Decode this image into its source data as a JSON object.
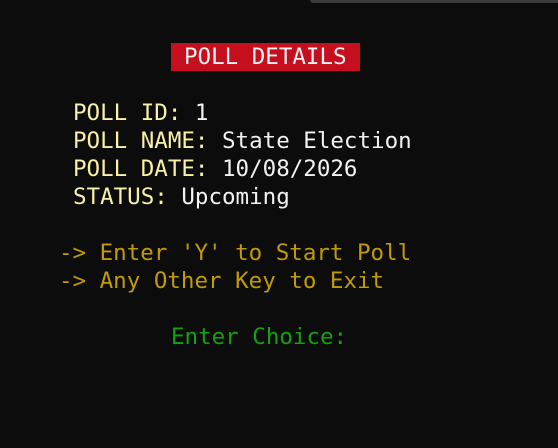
{
  "header": {
    "title": "POLL DETAILS"
  },
  "details": [
    {
      "key": "POLL ID:",
      "value": "1"
    },
    {
      "key": "POLL NAME:",
      "value": "State Election"
    },
    {
      "key": "POLL DATE:",
      "value": "10/08/2026"
    },
    {
      "key": "STATUS:",
      "value": "Upcoming"
    }
  ],
  "options": [
    "-> Enter 'Y' to Start Poll",
    "-> Any Other Key to Exit"
  ],
  "prompt": "Enter Choice:",
  "colors": {
    "background": "#0c0c0c",
    "title_bg": "#c50f1f",
    "title_fg": "#f2f2f2",
    "label": "#f9f1a5",
    "value": "#f2f2f2",
    "option": "#c19c00",
    "prompt": "#13a10e"
  }
}
